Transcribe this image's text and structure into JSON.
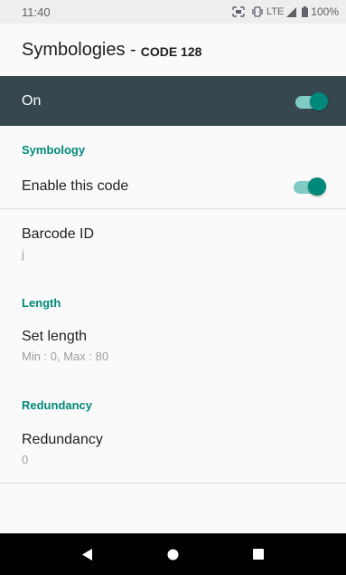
{
  "status_bar": {
    "time": "11:40",
    "network": "LTE",
    "battery": "100%",
    "icons": [
      "scan-icon",
      "vibrate-icon",
      "signal-icon",
      "battery-icon"
    ]
  },
  "app_bar": {
    "title": "Symbologies -",
    "subtitle": "CODE 128"
  },
  "master_switch": {
    "label": "On",
    "checked": true
  },
  "sections": {
    "symbology": {
      "header": "Symbology",
      "enable": {
        "title": "Enable this code",
        "checked": true
      }
    },
    "barcode_id": {
      "title": "Barcode ID",
      "summary": "j"
    },
    "length": {
      "header": "Length",
      "set_length": {
        "title": "Set length",
        "summary": "Min : 0, Max : 80"
      }
    },
    "redundancy": {
      "header": "Redundancy",
      "item": {
        "title": "Redundancy",
        "summary": "0"
      }
    }
  },
  "nav_bar": {
    "buttons": [
      "back-icon",
      "home-icon",
      "recents-icon"
    ]
  },
  "colors": {
    "accent": "#00897b",
    "master_bar": "#37474f",
    "nav_bar": "#000000"
  }
}
